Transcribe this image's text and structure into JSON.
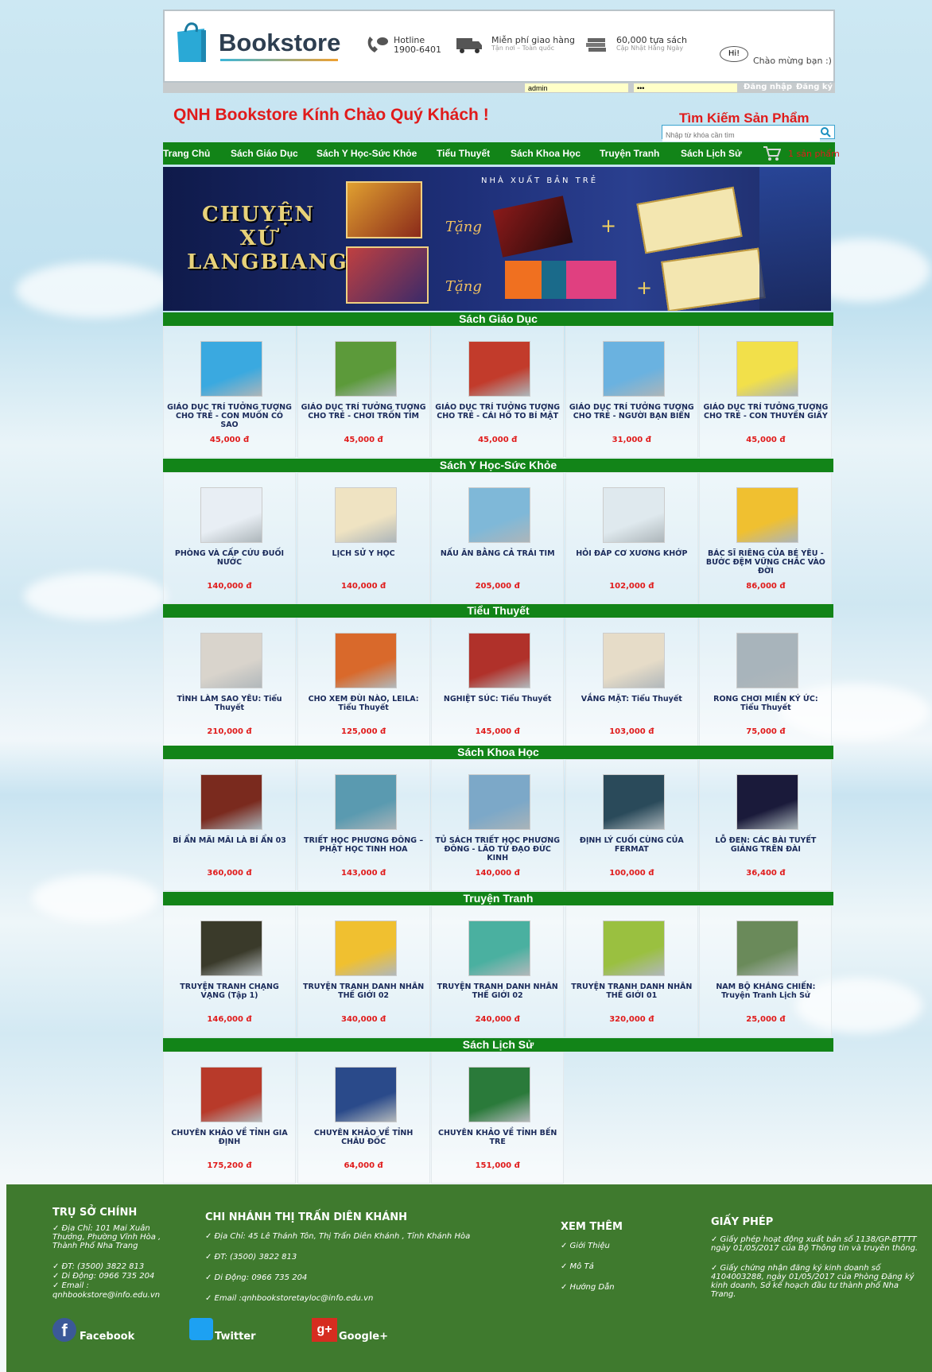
{
  "header": {
    "logo": "Bookstore",
    "hotline_label": "Hotline",
    "hotline_number": "1900-6401",
    "shipping_title": "Miễn phí giao hàng",
    "shipping_sub": "Tận nơi – Toàn quốc",
    "books_title": "60,000 tựa sách",
    "books_sub": "Cập Nhật Hằng Ngày",
    "hi_bubble": "Hi!",
    "greeting": "Chào mừng bạn :)"
  },
  "login": {
    "username": "admin",
    "password": "•••",
    "login_label": "Đăng nhập",
    "register_label": "Đăng ký"
  },
  "welcome": "QNH Bookstore Kính Chào Quý Khách !",
  "search": {
    "title": "Tìm Kiếm Sản Phẩm",
    "placeholder": "Nhập từ khóa cần tìm"
  },
  "nav": {
    "items": [
      "Trang Chủ",
      "Sách Giáo Dục",
      "Sách Y Học-Sức Khỏe",
      "Tiểu Thuyết",
      "Sách Khoa Học",
      "Truyện Tranh",
      "Sách Lịch Sử"
    ],
    "cart_count": "1",
    "cart_label": "sản phẩm"
  },
  "banner": {
    "title_line1": "CHUYỆN",
    "title_line2": "XỨ",
    "title_line3": "LANGBIANG",
    "publisher": "NHÀ XUẤT BẢN TRẺ",
    "gift1": "Tặng",
    "gift2": "Tặng"
  },
  "sections": [
    {
      "title": "Sách Giáo Dục",
      "products": [
        {
          "title": "GIÁO DỤC TRÍ TƯỞNG TƯỢNG CHO TRẺ - CON MUỐN CÓ SAO",
          "price": "45,000 đ",
          "color": "#3aa9e0"
        },
        {
          "title": "GIÁO DỤC TRÍ TƯỞNG TƯỢNG CHO TRẺ - CHƠI TRỐN TÌM",
          "price": "45,000 đ",
          "color": "#5c9a3a"
        },
        {
          "title": "GIÁO DỤC TRÍ TƯỞNG TƯỢNG CHO TRẺ - CÁI HỐ TO BÍ MẬT",
          "price": "45,000 đ",
          "color": "#c23b2b"
        },
        {
          "title": "GIÁO DỤC TRÍ TƯỞNG TƯỢNG CHO TRẺ - NGƯỜI BẠN BIỂN",
          "price": "31,000 đ",
          "color": "#6ab2e0"
        },
        {
          "title": "GIÁO DỤC TRÍ TƯỞNG TƯỢNG CHO TRẺ - CON THUYỀN GIẤY",
          "price": "45,000 đ",
          "color": "#f2e04a"
        }
      ]
    },
    {
      "title": "Sách Y Học-Sức Khỏe",
      "products": [
        {
          "title": "PHÒNG VÀ CẤP CỨU ĐUỐI NƯỚC",
          "price": "140,000 đ",
          "color": "#e8eef4"
        },
        {
          "title": "LỊCH SỬ Y HỌC",
          "price": "140,000 đ",
          "color": "#efe3c2"
        },
        {
          "title": "NẤU ĂN BẰNG CẢ TRÁI TIM",
          "price": "205,000 đ",
          "color": "#7fb8d8"
        },
        {
          "title": "HỎI ĐÁP CƠ XƯƠNG KHỚP",
          "price": "102,000 đ",
          "color": "#dfe9ee"
        },
        {
          "title": "BÁC SĨ RIÊNG CỦA BÉ YÊU - BƯỚC ĐỆM VỮNG CHẮC VÀO ĐỜI",
          "price": "86,000 đ",
          "color": "#f0c030"
        }
      ]
    },
    {
      "title": "Tiểu Thuyết",
      "products": [
        {
          "title": "TÌNH LÀM SAO YÊU: Tiểu Thuyết",
          "price": "210,000 đ",
          "color": "#d9d4cc"
        },
        {
          "title": "CHO XEM ĐÙI NÀO, LEILA: Tiểu Thuyết",
          "price": "125,000 đ",
          "color": "#d9692b"
        },
        {
          "title": "NGHIỆT SÚC: Tiểu Thuyết",
          "price": "145,000 đ",
          "color": "#b0312a"
        },
        {
          "title": "VẮNG MẶT: Tiểu Thuyết",
          "price": "103,000 đ",
          "color": "#e6dcc8"
        },
        {
          "title": "RONG CHƠI MIỀN KÝ ỨC: Tiểu Thuyết",
          "price": "75,000 đ",
          "color": "#a8b4bb"
        }
      ]
    },
    {
      "title": "Sách Khoa Học",
      "products": [
        {
          "title": "BÍ ẨN MÃI MÃI LÀ BÍ ẨN 03",
          "price": "360,000 đ",
          "color": "#7a2a1e"
        },
        {
          "title": "TRIẾT HỌC PHƯƠNG ĐÔNG – PHẬT HỌC TINH HOA",
          "price": "143,000 đ",
          "color": "#5a9ab0"
        },
        {
          "title": "TỦ SÁCH TRIẾT HỌC PHƯƠNG ĐÔNG - LÃO TỬ ĐẠO ĐỨC KINH",
          "price": "140,000 đ",
          "color": "#7ca8c8"
        },
        {
          "title": "ĐỊNH LÝ CUỐI CÙNG CỦA FERMAT",
          "price": "100,000 đ",
          "color": "#2a4a5a"
        },
        {
          "title": "LỖ ĐEN: CÁC BÀI TUYẾT GIẢNG TRÊN ĐÀI",
          "price": "36,400 đ",
          "color": "#1a1a3a"
        }
      ]
    },
    {
      "title": "Truyện Tranh",
      "products": [
        {
          "title": "TRUYỆN TRANH CHẠNG VẠNG (Tập 1)",
          "price": "146,000 đ",
          "color": "#3a3a2a"
        },
        {
          "title": "TRUYỆN TRANH DANH NHÂN THẾ GIỚI 02",
          "price": "340,000 đ",
          "color": "#f0c030"
        },
        {
          "title": "TRUYỆN TRANH DANH NHÂN THẾ GIỚI 02",
          "price": "240,000 đ",
          "color": "#4ab0a0"
        },
        {
          "title": "TRUYỆN TRANH DANH NHÂN THẾ GIỚI 01",
          "price": "320,000 đ",
          "color": "#9ac040"
        },
        {
          "title": "NAM BỘ KHÁNG CHIẾN: Truyện Tranh Lịch Sử",
          "price": "25,000 đ",
          "color": "#6a8a5a"
        }
      ]
    },
    {
      "title": "Sách Lịch Sử",
      "products": [
        {
          "title": "CHUYÊN KHẢO VỀ TỈNH GIA ĐỊNH",
          "price": "175,200 đ",
          "color": "#b83a2a"
        },
        {
          "title": "CHUYÊN KHẢO VỀ TỈNH CHÂU ĐỐC",
          "price": "64,000 đ",
          "color": "#2a4a8a"
        },
        {
          "title": "CHUYÊN KHẢO VỀ TỈNH BẾN TRE",
          "price": "151,000 đ",
          "color": "#2a7a3a"
        }
      ]
    }
  ],
  "footer": {
    "hq_title": "TRỤ SỞ CHÍNH",
    "hq_addr": "✓ Địa Chỉ: 101 Mai Xuân Thưởng, Phường Vĩnh Hòa , Thành Phố Nha Trang",
    "hq_phone": "✓ ĐT: (3500) 3822 813",
    "hq_mobile": "✓ Di Động: 0966 735 204",
    "hq_email_label": "✓ Email :",
    "hq_email": "qnhbookstore@info.edu.vn",
    "branch_title": "CHI NHÁNH THỊ TRẤN DIÊN KHÁNH",
    "branch_addr": "✓ Địa Chỉ: 45 Lê Thánh Tôn, Thị Trấn Diên Khánh , Tỉnh Khánh Hòa",
    "branch_phone": "✓ ĐT: (3500) 3822 813",
    "branch_mobile": "✓ Di Động: 0966 735 204",
    "branch_email": "✓ Email :qnhbookstoretayloc@info.edu.vn",
    "more_title": "XEM THÊM",
    "more_items": [
      "✓ Giới Thiệu",
      "✓ Mô Tả",
      "✓ Hướng Dẫn"
    ],
    "license_title": "GIẤY PHÉP",
    "license1": "✓ Giấy phép hoạt động xuất bản số 1138/GP-BTTTT ngày 01/05/2017 của Bộ Thông tin và truyền thông.",
    "license2": "✓ Giấy chứng nhận đăng ký kinh doanh số 4104003288, ngày 01/05/2017 của Phòng Đăng ký kinh doanh, Sở kế hoạch đầu tư thành phố Nha Trang.",
    "social": [
      "Facebook",
      "Twitter",
      "Google+"
    ]
  }
}
